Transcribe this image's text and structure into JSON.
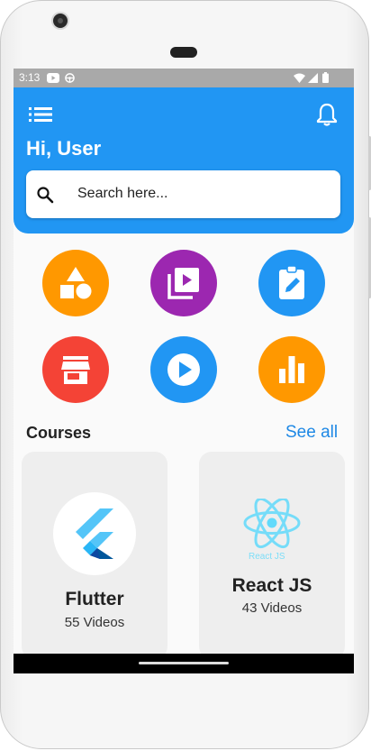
{
  "status_bar": {
    "time": "3:13"
  },
  "header": {
    "greeting": "Hi, User"
  },
  "search": {
    "placeholder": "Search here..."
  },
  "categories": [
    {
      "icon": "shapes-icon",
      "color": "#ff9800"
    },
    {
      "icon": "video-library-icon",
      "color": "#9c27b0"
    },
    {
      "icon": "assignment-edit-icon",
      "color": "#2196f3"
    },
    {
      "icon": "store-icon",
      "color": "#f44336"
    },
    {
      "icon": "play-circle-icon",
      "color": "#2196f3"
    },
    {
      "icon": "bar-chart-icon",
      "color": "#ff9800"
    }
  ],
  "courses": {
    "title": "Courses",
    "see_all": "See all",
    "items": [
      {
        "name": "Flutter",
        "videos": "55 Videos",
        "icon": "flutter-logo-icon"
      },
      {
        "name": "React JS",
        "videos": "43 Videos",
        "icon": "react-logo-icon",
        "logo_caption": "React JS"
      }
    ]
  },
  "colors": {
    "primary": "#2196f3",
    "card": "#eeeeee",
    "link": "#1e88e5"
  }
}
